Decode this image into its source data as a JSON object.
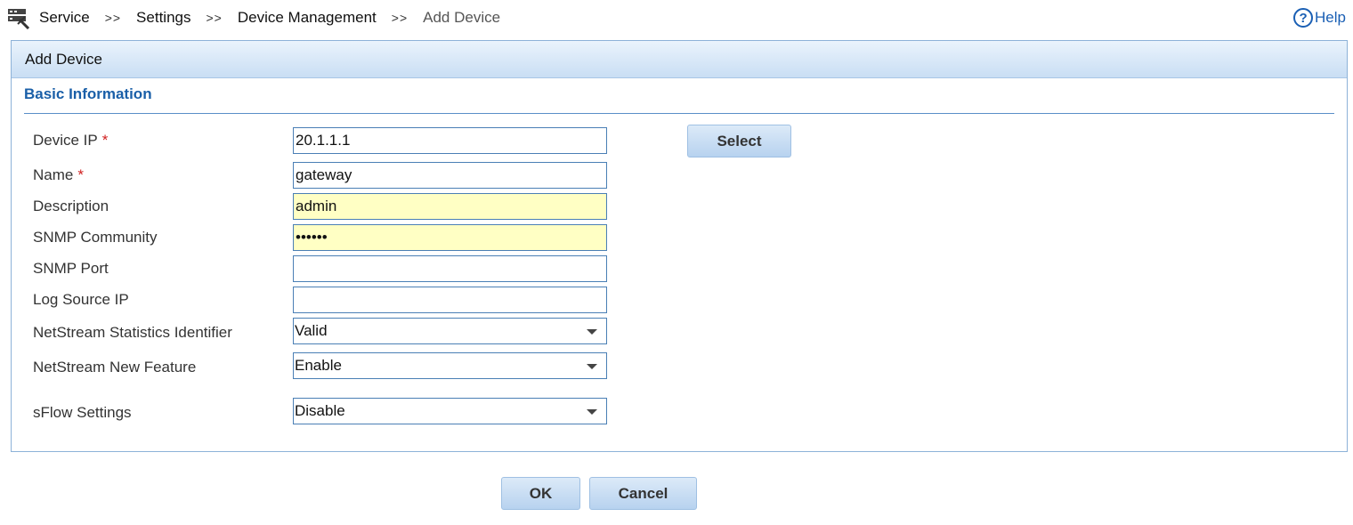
{
  "breadcrumb": {
    "items": [
      "Service",
      "Settings",
      "Device Management"
    ],
    "separator": ">>",
    "current": "Add Device"
  },
  "help": {
    "label": "Help"
  },
  "panel": {
    "title": "Add Device",
    "section_title": "Basic Information"
  },
  "form": {
    "device_ip": {
      "label": "Device IP",
      "required_mark": "*",
      "value": "20.1.1.1"
    },
    "name": {
      "label": "Name",
      "required_mark": "*",
      "value": "gateway"
    },
    "description": {
      "label": "Description",
      "value": "admin"
    },
    "snmp_community": {
      "label": "SNMP Community",
      "value": "••••••"
    },
    "snmp_port": {
      "label": "SNMP Port",
      "value": ""
    },
    "log_source_ip": {
      "label": "Log Source IP",
      "value": ""
    },
    "netstream_stats": {
      "label": "NetStream Statistics Identifier",
      "selected": "Valid"
    },
    "netstream_feature": {
      "label": "NetStream New Feature",
      "selected": "Enable"
    },
    "sflow": {
      "label": "sFlow Settings",
      "selected": "Disable"
    },
    "select_button": "Select"
  },
  "buttons": {
    "ok": "OK",
    "cancel": "Cancel"
  },
  "colors": {
    "accent": "#1a5fa8",
    "highlight_field": "#ffffc4",
    "required": "#d02020"
  }
}
